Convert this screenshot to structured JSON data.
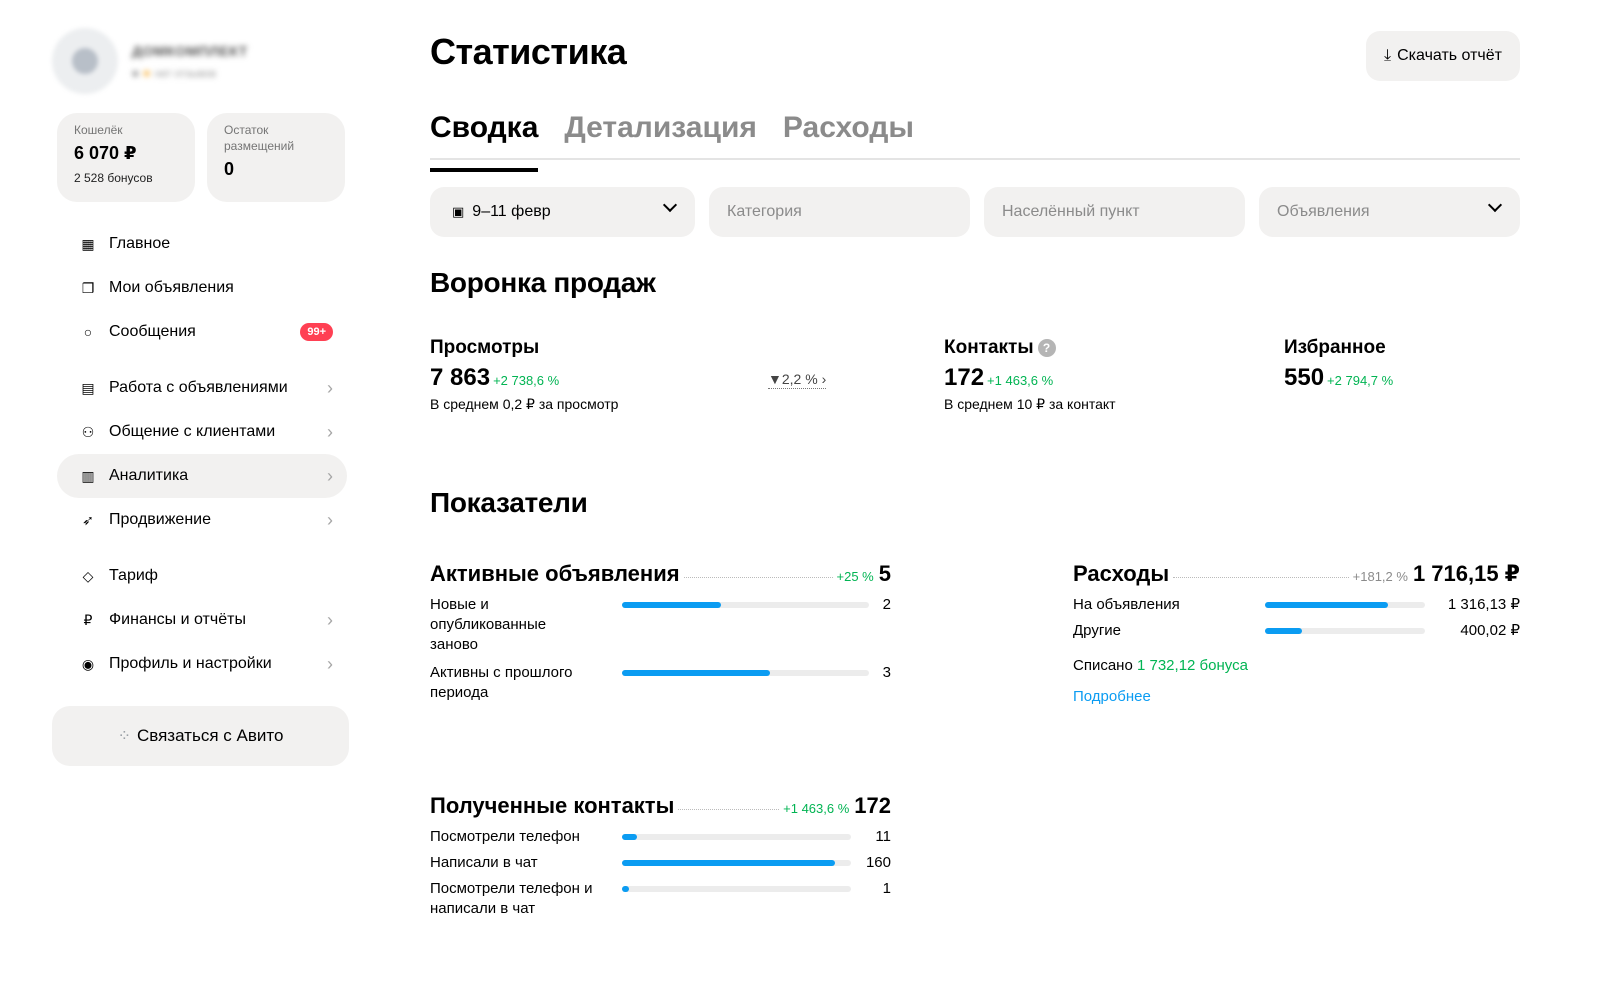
{
  "profile": {
    "name": "ДОМКОМПЛЕКТ",
    "rating": "нет отзывов"
  },
  "wallet": {
    "label": "Кошелёк",
    "value": "6 070 ₽",
    "bonus": "2 528 бонусов"
  },
  "placements": {
    "label": "Остаток размещений",
    "value": "0"
  },
  "nav": {
    "main": "Главное",
    "my_ads": "Мои объявления",
    "messages": "Сообщения",
    "messages_badge": "99+",
    "ads_work": "Работа с объявлениями",
    "clients": "Общение с клиентами",
    "analytics": "Аналитика",
    "promotion": "Продвижение",
    "tariff": "Тариф",
    "finance": "Финансы и отчёты",
    "profile": "Профиль и настройки"
  },
  "contact_button": "Связаться с Авито",
  "page": {
    "title": "Статистика",
    "download": "Скачать отчёт"
  },
  "tabs": [
    "Сводка",
    "Детализация",
    "Расходы"
  ],
  "filters": {
    "date": "9–11 февр",
    "category": "Категория",
    "city": "Населённый пункт",
    "ads": "Объявления"
  },
  "funnel": {
    "title": "Воронка продаж",
    "views": {
      "title": "Просмотры",
      "value": "7 863",
      "delta": "+2 738,6 %",
      "note": "В среднем 0,2 ₽ за просмотр"
    },
    "conversion": "2,2 %",
    "contacts": {
      "title": "Контакты",
      "value": "172",
      "delta": "+1 463,6 %",
      "note": "В среднем 10 ₽ за контакт"
    },
    "favorites": {
      "title": "Избранное",
      "value": "550",
      "delta": "+2 794,7 %"
    }
  },
  "metrics": {
    "title": "Показатели",
    "active_ads": {
      "title": "Активные объявления",
      "delta": "+25 %",
      "value": "5",
      "rows": [
        {
          "label": "Новые и опубликованные заново",
          "value": "2",
          "share": 0.4
        },
        {
          "label": "Активны с прошлого периода",
          "value": "3",
          "share": 0.6
        }
      ]
    },
    "expenses": {
      "title": "Расходы",
      "delta": "+181,2 %",
      "value": "1 716,15 ₽",
      "rows": [
        {
          "label": "На объявления",
          "value": "1 316,13 ₽",
          "share": 0.77
        },
        {
          "label": "Другие",
          "value": "400,02 ₽",
          "share": 0.23
        }
      ],
      "written_off_prefix": "Списано",
      "written_off_value": "1 732,12 бонуса",
      "more": "Подробнее"
    },
    "contacts": {
      "title": "Полученные контакты",
      "delta": "+1 463,6 %",
      "value": "172",
      "rows": [
        {
          "label": "Посмотрели телефон",
          "value": "11",
          "share": 0.064
        },
        {
          "label": "Написали в чат",
          "value": "160",
          "share": 0.93
        },
        {
          "label": "Посмотрели телефон и написали в чат",
          "value": "1",
          "share": 0.03
        }
      ]
    }
  },
  "colors": {
    "accent": "#0b9cf2",
    "positive": "#02b453",
    "badge": "#ff4053",
    "panel": "#f2f1f0"
  },
  "icons": {
    "main": "grid-icon",
    "my_ads": "copy-icon",
    "messages": "chat-icon",
    "ads_work": "calendar-icon",
    "clients": "users-icon",
    "analytics": "bar-chart-icon",
    "promotion": "rocket-icon",
    "tariff": "diamond-icon",
    "finance": "ruble-icon",
    "profile": "user-circle-icon",
    "download": "download-icon",
    "filter": "funnel-icon"
  }
}
